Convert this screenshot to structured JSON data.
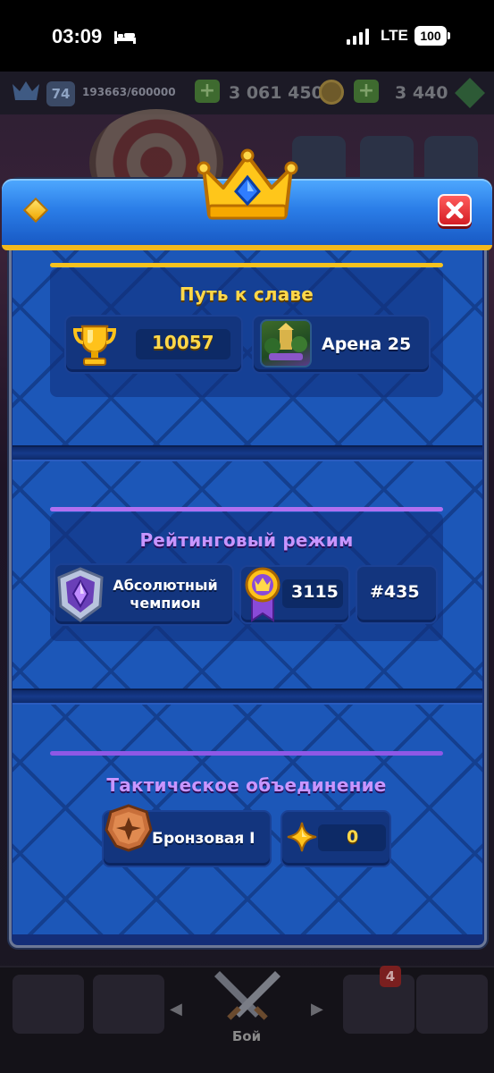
{
  "status_bar": {
    "time": "03:09",
    "network": "LTE",
    "battery": "100"
  },
  "resources": {
    "level": "74",
    "xp": "193663/600000",
    "gold": "3 061 450",
    "gems": "3 440"
  },
  "bottom_nav": {
    "active_label": "Бой",
    "badge_count": "4"
  },
  "modal": {
    "sections": [
      {
        "title": "Путь к славе",
        "trophies": "10057",
        "arena": "Арена 25"
      },
      {
        "title": "Рейтинговый режим",
        "league": "Абсолютный чемпион",
        "rating": "3115",
        "rank": "#435"
      },
      {
        "title": "Тактическое объединение",
        "league": "Бронзовая I",
        "stars": "0"
      }
    ]
  },
  "colors": {
    "gold_accent": "#ffd84a",
    "purple_accent": "#c896ff",
    "panel_blue": "#1c57b8",
    "header_blue": "#2b7ee8",
    "close_red": "#d41e25"
  },
  "icons": [
    "bed-icon",
    "signal-icon",
    "crown-icon",
    "gem-icon",
    "close-icon",
    "trophy-icon",
    "champion-badge-icon",
    "rating-medal-icon",
    "bronze-badge-icon",
    "star-icon",
    "swords-icon"
  ]
}
